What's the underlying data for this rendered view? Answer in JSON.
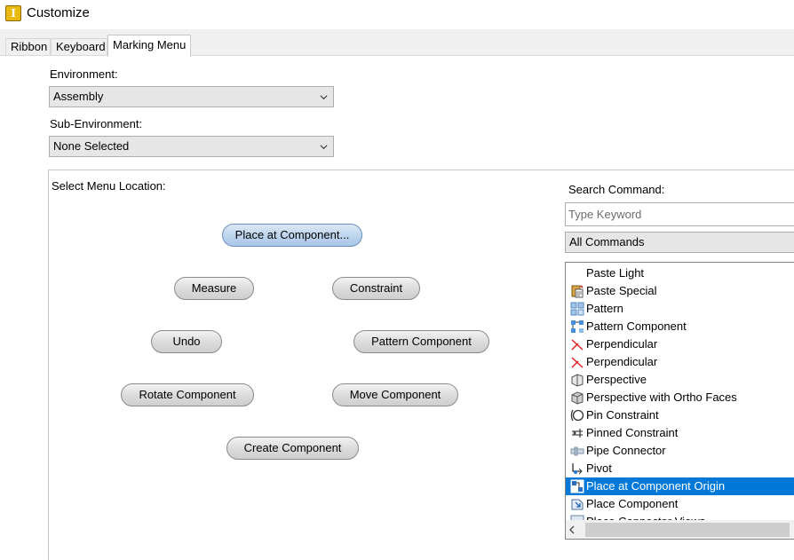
{
  "window": {
    "title": "Customize",
    "app_icon_letter": "I"
  },
  "tabs": [
    {
      "label": "Ribbon",
      "active": false
    },
    {
      "label": "Keyboard",
      "active": false
    },
    {
      "label": "Marking Menu",
      "active": true
    }
  ],
  "environment": {
    "label": "Environment:",
    "value": "Assembly"
  },
  "sub_environment": {
    "label": "Sub-Environment:",
    "value": "None Selected"
  },
  "menu_location": {
    "label": "Select Menu Location:",
    "items": [
      {
        "label": "Place  at  Component...",
        "selected": true
      },
      {
        "label": "Measure"
      },
      {
        "label": "Constraint"
      },
      {
        "label": "Undo"
      },
      {
        "label": "Pattern Component"
      },
      {
        "label": "Rotate Component"
      },
      {
        "label": "Move Component"
      },
      {
        "label": "Create Component"
      }
    ]
  },
  "search": {
    "label": "Search Command:",
    "placeholder": "Type Keyword",
    "filter_value": "All Commands"
  },
  "commands": [
    {
      "label": "Paste Light",
      "icon": "none"
    },
    {
      "label": "Paste Special",
      "icon": "paste-special-icon"
    },
    {
      "label": "Pattern",
      "icon": "pattern-icon"
    },
    {
      "label": "Pattern Component",
      "icon": "pattern-component-icon"
    },
    {
      "label": "Perpendicular",
      "icon": "perpendicular-icon"
    },
    {
      "label": "Perpendicular",
      "icon": "perpendicular-icon"
    },
    {
      "label": "Perspective",
      "icon": "perspective-icon"
    },
    {
      "label": "Perspective with Ortho Faces",
      "icon": "perspective-ortho-icon"
    },
    {
      "label": "Pin Constraint",
      "icon": "pin-constraint-icon"
    },
    {
      "label": "Pinned Constraint",
      "icon": "pinned-constraint-icon"
    },
    {
      "label": "Pipe Connector",
      "icon": "pipe-connector-icon"
    },
    {
      "label": "Pivot",
      "icon": "pivot-icon"
    },
    {
      "label": "Place at Component Origin",
      "icon": "place-origin-icon",
      "selected": true
    },
    {
      "label": "Place Component",
      "icon": "place-component-icon"
    },
    {
      "label": "Place Connector Views",
      "icon": "place-connector-views-icon"
    }
  ],
  "colors": {
    "selection": "#0078d7",
    "pill_selected": "#bcd4ee"
  }
}
